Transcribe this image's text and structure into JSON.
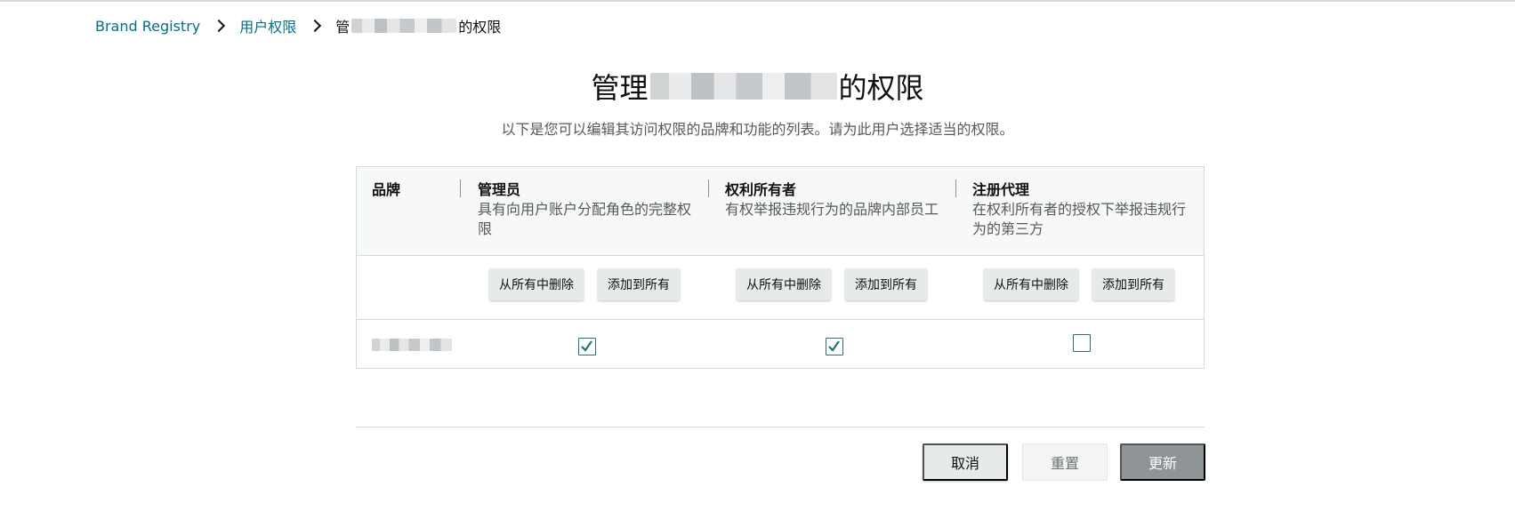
{
  "breadcrumb": {
    "root": "Brand Registry",
    "section": "用户权限",
    "current_prefix": "管",
    "current_suffix": "的权限"
  },
  "header": {
    "title_prefix": "管理",
    "title_suffix": "的权限",
    "subtitle": "以下是您可以编辑其访问权限的品牌和功能的列表。请为此用户选择适当的权限。"
  },
  "table": {
    "brand_header": "品牌",
    "roles": [
      {
        "name": "管理员",
        "desc_line1": "具有向用户账户分配角色的完整权",
        "desc_line2": "限"
      },
      {
        "name": "权利所有者",
        "desc_line1": "有权举报违规行为的品牌内部员工",
        "desc_line2": ""
      },
      {
        "name": "注册代理",
        "desc_line1": "在权利所有者的授权下举报违规行",
        "desc_line2": "为的第三方"
      }
    ],
    "remove_all_label": "从所有中删除",
    "add_all_label": "添加到所有",
    "rows": [
      {
        "checked": [
          true,
          true,
          false
        ]
      }
    ]
  },
  "footer": {
    "cancel": "取消",
    "reset": "重置",
    "update": "更新"
  },
  "colors": {
    "link": "#007185",
    "checkbox": "#2a6f7b",
    "update_button": "#8f9596"
  },
  "icons": [
    "chevron-right-icon",
    "checkbox-checked-icon",
    "checkbox-empty-icon"
  ]
}
